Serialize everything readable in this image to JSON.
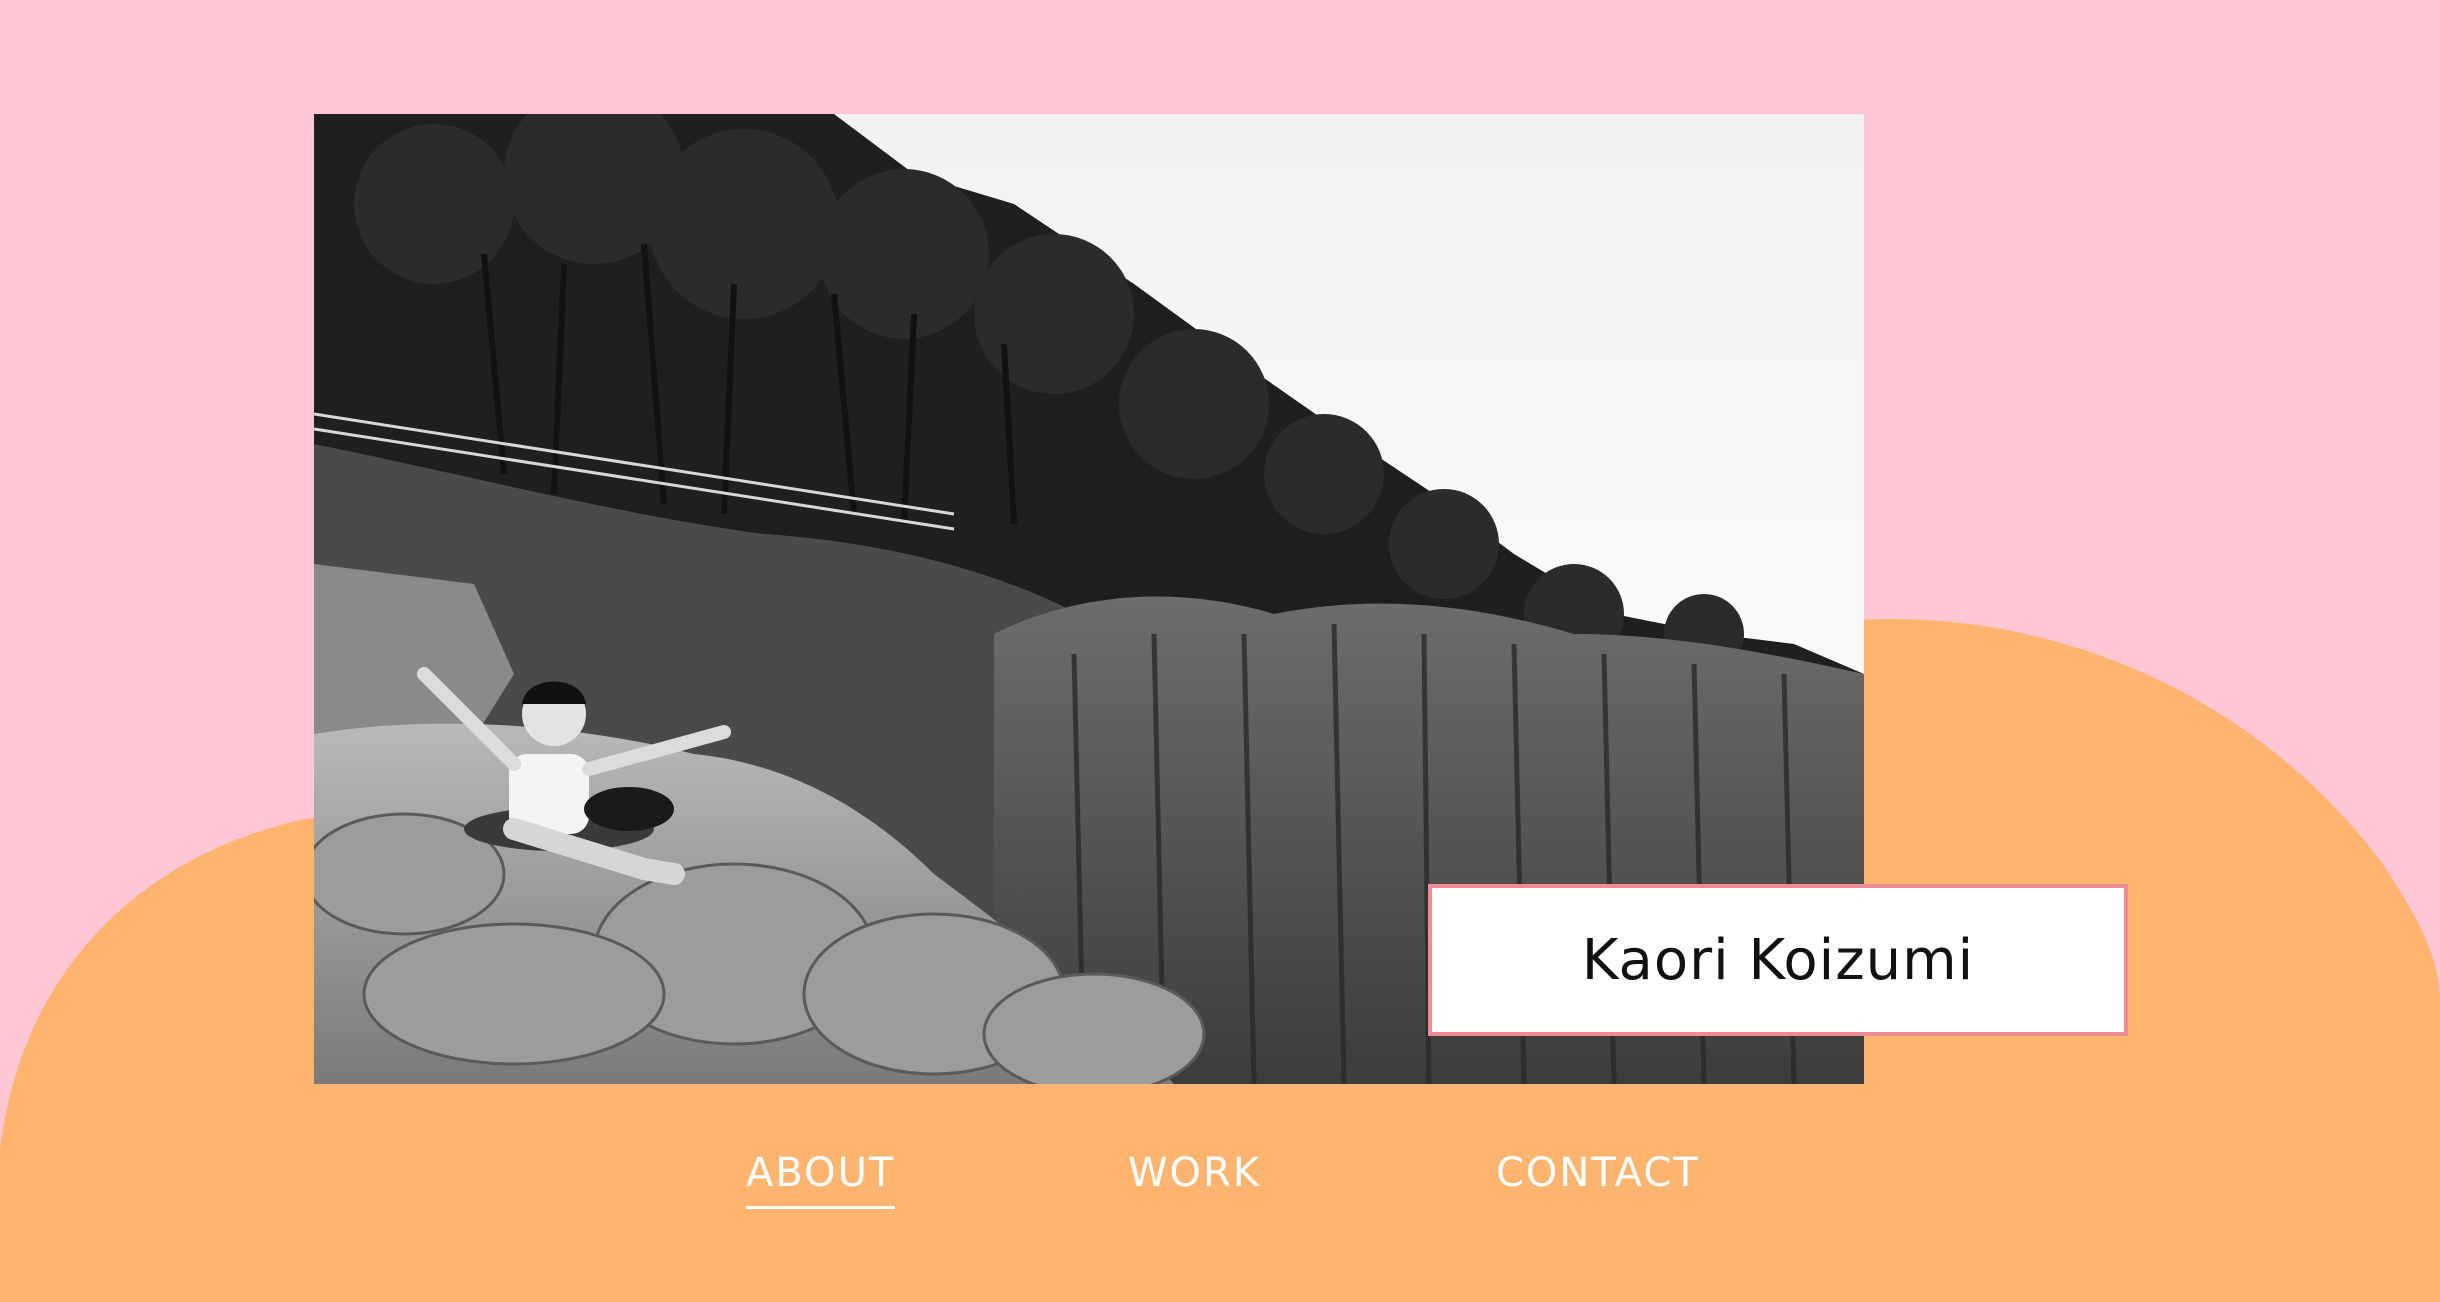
{
  "colors": {
    "background_pink": "#ffc6d3",
    "blob_orange": "#fdb46e",
    "card_border": "#f08b92",
    "nav_text": "#ffffff"
  },
  "hero": {
    "photo_description_icon": "photo-mountain-cliff-person"
  },
  "name_card": {
    "name": "Kaori Koizumi"
  },
  "nav": {
    "items": [
      {
        "label": "ABOUT",
        "active": true
      },
      {
        "label": "WORK",
        "active": false
      },
      {
        "label": "CONTACT",
        "active": false
      }
    ]
  }
}
